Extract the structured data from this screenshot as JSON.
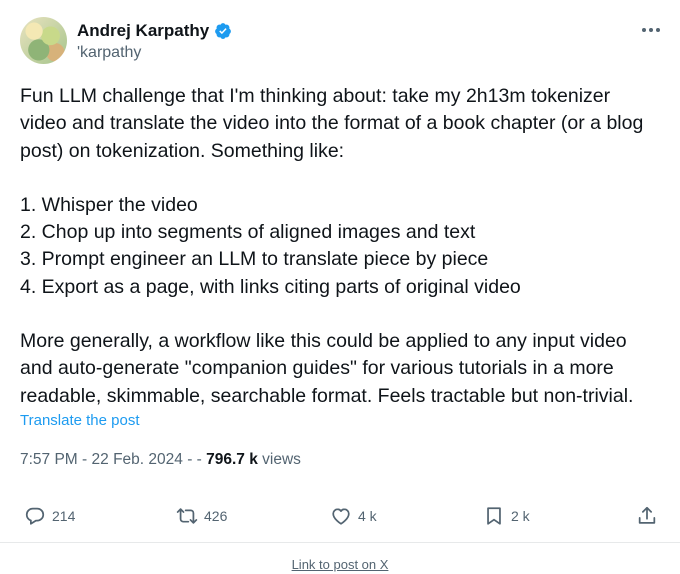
{
  "author": {
    "name": "Andrej Karpathy",
    "handle": "'karpathy",
    "verified": true
  },
  "post": {
    "intro": "Fun LLM challenge that I'm thinking about: take my 2h13m tokenizer video and translate the video into the format of a book chapter (or a blog post) on tokenization. Something like:",
    "steps": [
      "1. Whisper the video",
      "2. Chop up into segments of aligned images and text",
      "3. Prompt engineer an LLM to translate piece by piece",
      "4. Export as a page, with links citing parts of original video"
    ],
    "outro": "More generally, a workflow like this could be applied to any input video and auto-generate \"companion guides\" for various tutorials in a more readable, skimmable, searchable format. Feels tractable but non-trivial.",
    "translate_label": "Translate the post"
  },
  "meta": {
    "time": "7:57 PM",
    "date": "22 Feb. 2024",
    "views_count": "796.7 k",
    "views_label": "views"
  },
  "actions": {
    "replies": "214",
    "reposts": "426",
    "likes": "4 k",
    "bookmarks": "2 k"
  },
  "footer_link": "Link to post on X",
  "colors": {
    "text": "#0f1419",
    "secondary": "#536471",
    "accent": "#1d9bf0"
  }
}
